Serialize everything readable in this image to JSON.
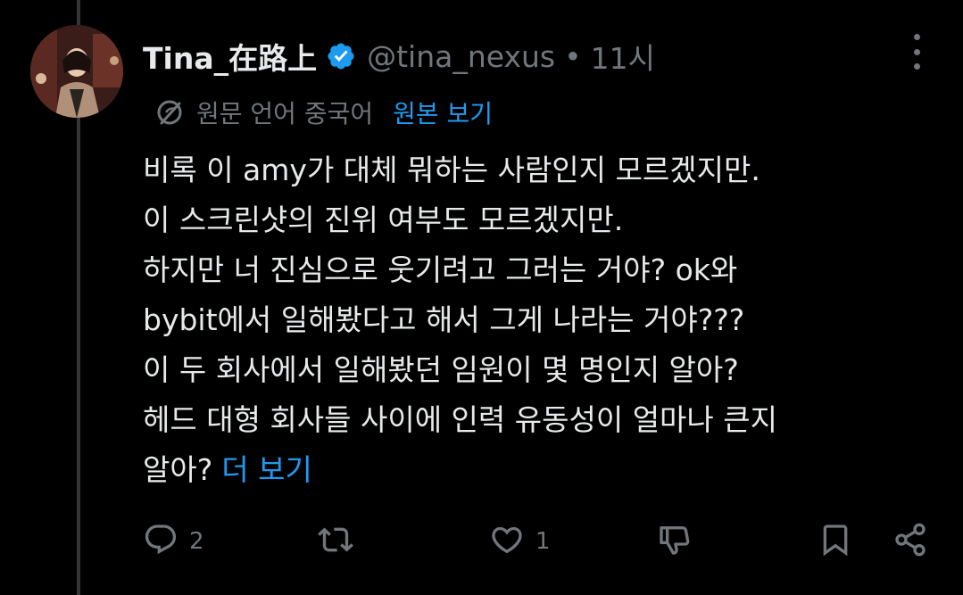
{
  "tweet": {
    "author": {
      "display_name": "Tina_在路上",
      "handle": "@tina_nexus",
      "verified": true
    },
    "separator": "•",
    "time": "11시",
    "translation": {
      "label": "원문 언어 중국어",
      "link": "원본 보기"
    },
    "lines": [
      "비록 이 amy가 대체 뭐하는 사람인지 모르겠지만.",
      "이 스크린샷의 진위 여부도 모르겠지만.",
      "하지만 너 진심으로 웃기려고 그러는 거야? ok와",
      "bybit에서 일해봤다고 해서 그게 나라는 거야???",
      "이 두 회사에서 일해봤던 임원이 몇 명인지 알아?",
      "헤드 대형 회사들 사이에 인력 유동성이 얼마나 큰지",
      "알아?"
    ],
    "show_more": "더 보기",
    "actions": {
      "reply_count": "2",
      "retweet_count": "",
      "like_count": "1"
    }
  },
  "colors": {
    "background": "#000000",
    "text": "#e7e9ea",
    "muted": "#71767b",
    "accent": "#1d9bf0",
    "thread_line": "#333639"
  },
  "icons": [
    "more-icon",
    "verified-badge-icon",
    "translate-icon",
    "reply-icon",
    "retweet-icon",
    "like-icon",
    "dislike-icon",
    "bookmark-icon",
    "share-icon"
  ]
}
